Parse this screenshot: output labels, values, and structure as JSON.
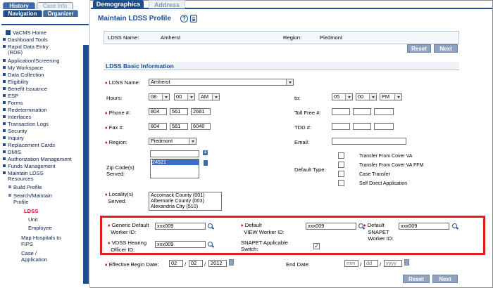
{
  "sidebar": {
    "tabs": {
      "history": "History",
      "case_info": "Case Info",
      "navigation": "Navigation",
      "organizer": "Organizer"
    },
    "items": [
      {
        "label": "VaCMS Home"
      },
      {
        "label": "Dashboard Tools"
      },
      {
        "label": "Rapid Data Entry"
      },
      {
        "label": "(RDE)"
      },
      {
        "label": "Application/Screening"
      },
      {
        "label": "My Workspace"
      },
      {
        "label": "Data Collection"
      },
      {
        "label": "Eligibility"
      },
      {
        "label": "Benefit Issuance"
      },
      {
        "label": "ESP"
      },
      {
        "label": "Forms"
      },
      {
        "label": "Redetermination"
      },
      {
        "label": "Interfaces"
      },
      {
        "label": "Transaction Logs"
      },
      {
        "label": "Security"
      },
      {
        "label": "Inquiry"
      },
      {
        "label": "Replacement Cards"
      },
      {
        "label": "DMIS"
      },
      {
        "label": "Authorization Management"
      },
      {
        "label": "Funds Management"
      },
      {
        "label": "Maintain LDSS"
      },
      {
        "label": "Resources"
      },
      {
        "label": "Build Profile"
      },
      {
        "label": "Search/Maintain"
      },
      {
        "label": "Profile"
      },
      {
        "label": "LDSS"
      },
      {
        "label": "Unit"
      },
      {
        "label": "Employee"
      },
      {
        "label": "Map Hospitals to"
      },
      {
        "label": "FIPS"
      },
      {
        "label": "Case /"
      },
      {
        "label": "Application"
      }
    ]
  },
  "main": {
    "tabs": {
      "demographics": "Demographics",
      "address": "Address"
    },
    "title": "Maintain LDSS Profile",
    "header": {
      "ldss_name_label": "LDSS Name:",
      "ldss_name_value": "Amherst",
      "region_label": "Region:",
      "region_value": "Piedmont"
    },
    "buttons": {
      "reset": "Reset",
      "next": "Next"
    },
    "section_title": "LDSS Basic Information",
    "form": {
      "ldss_name_label": "LDSS Name:",
      "ldss_name_value": "Amherst",
      "hours_label": "Hours:",
      "hours_from": {
        "h": "08",
        "m": "00",
        "ampm": "AM"
      },
      "to_label": "to:",
      "hours_to": {
        "h": "05",
        "m": "00",
        "ampm": "PM"
      },
      "phone_label": "Phone #:",
      "phone": [
        "804",
        "561",
        "2681"
      ],
      "tollfree_label": "Toll Free #:",
      "fax_label": "Fax #:",
      "fax": [
        "804",
        "561",
        "6040"
      ],
      "tdd_label": "TDD #:",
      "region_label": "Region:",
      "region_value": "Piedmont",
      "email_label": "Email:",
      "zip_label": "Zip Code(s) Served:",
      "zip_selected": "24521",
      "default_type_label": "Default Type:",
      "default_types": [
        "Transfer From Cover VA",
        "Transfer From Cover VA FFM",
        "Case Transfer",
        "Self Direct Application"
      ],
      "locality_label": "Locality(s) Served:",
      "localities": [
        "Accomack County (001)",
        "Albemarle County (003)",
        "Alexandria City (510)"
      ],
      "generic_worker_label": "Generic Default Worker ID:",
      "generic_worker_value": "xxx009",
      "default_view_worker_label": "Default VIEW Worker ID:",
      "default_view_worker_value": "xxx009",
      "default_snapet_label": "Default SNAPET Worker ID:",
      "default_snapet_value": "xxx009",
      "vdss_hearing_label": "VDSS Hearing Officer ID:",
      "vdss_hearing_value": "xxx009",
      "snapet_switch_label": "SNAPET Applicable Switch:",
      "snapet_switch_checked": "✓",
      "effective_begin_label": "Effective Begin Date:",
      "begin": [
        "02",
        "02",
        "2012"
      ],
      "end_label": "End Date:",
      "end": [
        "mm",
        "dd",
        "yyyy"
      ],
      "date_sep": "/"
    }
  }
}
